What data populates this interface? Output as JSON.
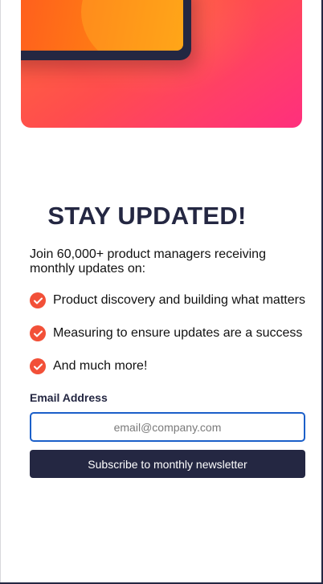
{
  "signup": {
    "title": "STAY UPDATED!",
    "intro": "Join 60,000+ product managers receiving monthly updates on:",
    "benefits": [
      {
        "icon": "check-icon",
        "text": "Product discovery and building what matters"
      },
      {
        "icon": "check-icon",
        "text": "Measuring to ensure updates are a success"
      },
      {
        "icon": "check-icon",
        "text": "And much more!"
      }
    ],
    "email_label": "Email Address",
    "email_placeholder": "email@company.com",
    "email_value": "",
    "submit_label": "Subscribe to monthly newsletter"
  },
  "colors": {
    "brand_dark": "#242742",
    "accent": "#f25038",
    "hero_gradient_start": "#ff6a3a",
    "hero_gradient_end": "#ff2f7d",
    "input_focus": "#1b5fc9"
  }
}
